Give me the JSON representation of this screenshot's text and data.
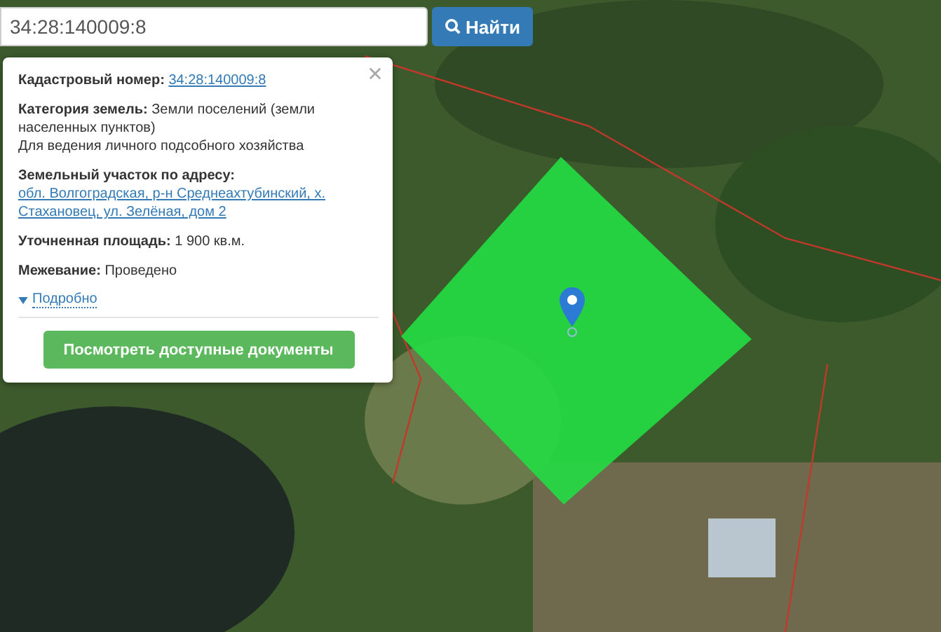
{
  "search": {
    "value": "34:28:140009:8",
    "button": "Найти"
  },
  "popup": {
    "fields": [
      {
        "label": "Кадастровый номер:",
        "value": "34:28:140009:8",
        "kind": "link"
      },
      {
        "label": "Категория земель:",
        "value": "Земли поселений (земли населенных пунктов)",
        "kind": "text",
        "note": "Для ведения личного подсобного хозяйства"
      },
      {
        "label": "Земельный участок по адресу:",
        "value": "обл. Волгоградская, р-н Среднеахтубинский, х. Стахановец, ул. Зелёная, дом 2",
        "kind": "link"
      },
      {
        "label": "Уточненная площадь:",
        "value": "1 900 кв.м.",
        "kind": "text"
      },
      {
        "label": "Межевание:",
        "value": "Проведено",
        "kind": "text"
      }
    ],
    "details": {
      "label": "Подробно",
      "expanded": false
    },
    "documents_button": "Посмотреть доступные документы"
  }
}
